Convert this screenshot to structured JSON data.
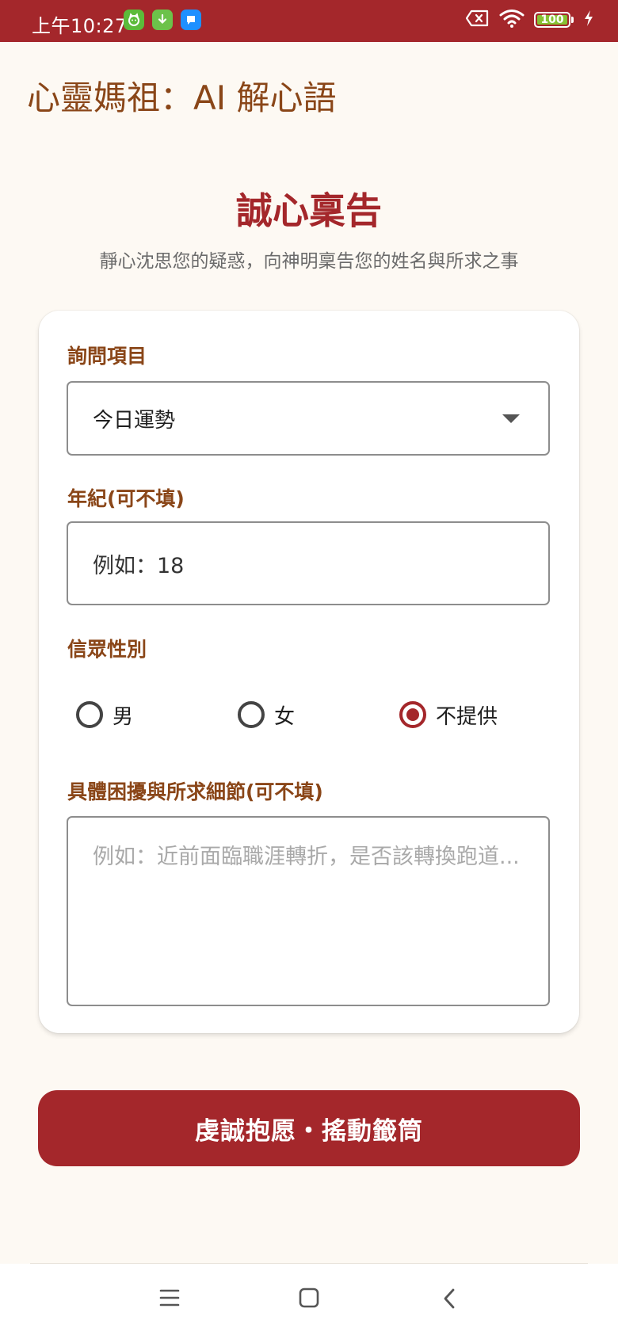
{
  "status_bar": {
    "time": "上午10:27",
    "battery": "100",
    "colors": {
      "bar": "#a4272b",
      "battery_fill": "#86c133"
    },
    "icons": [
      "cat-app-icon",
      "download-icon",
      "chat-app-icon",
      "no-sim-icon",
      "wifi-icon",
      "battery-icon",
      "charging-icon"
    ]
  },
  "header": {
    "title": "心靈媽祖：AI 解心語"
  },
  "intro": {
    "heading": "誠心稟告",
    "subtitle": "靜心沈思您的疑惑，向神明稟告您的姓名與所求之事"
  },
  "form": {
    "question_type": {
      "label": "詢問項目",
      "selected": "今日運勢",
      "icon": "chevron-down-icon"
    },
    "age": {
      "label": "年紀(可不填)",
      "value": "例如：18"
    },
    "gender": {
      "label": "信眾性別",
      "options": [
        {
          "label": "男",
          "checked": false
        },
        {
          "label": "女",
          "checked": false
        },
        {
          "label": "不提供",
          "checked": true
        }
      ]
    },
    "details": {
      "label": "具體困擾與所求細節(可不填)",
      "placeholder": "例如：近前面臨職涯轉折，是否該轉換跑道..."
    }
  },
  "submit": {
    "label": "虔誠抱愿・搖動籤筒"
  },
  "theme": {
    "primary": "#a4272b",
    "label_brown": "#8a4618",
    "background": "#fdf9f3"
  },
  "nav": {
    "icons": [
      "menu-icon",
      "home-icon",
      "back-icon"
    ]
  }
}
